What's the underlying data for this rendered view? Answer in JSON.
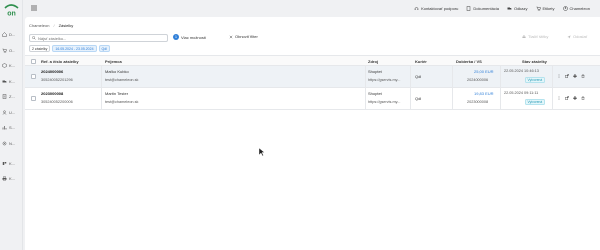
{
  "sidebar": {
    "logo_text": "on",
    "items": [
      {
        "label": "D...",
        "icon": "home-icon"
      },
      {
        "label": "O...",
        "icon": "cart-icon"
      },
      {
        "label": "K...",
        "icon": "cube-icon"
      },
      {
        "label": "K...",
        "icon": "truck-icon"
      },
      {
        "label": "Z...",
        "icon": "list-icon"
      },
      {
        "label": "U...",
        "icon": "users-icon"
      },
      {
        "label": "S...",
        "icon": "chart-icon"
      },
      {
        "label": "N...",
        "icon": "settings-icon"
      },
      {
        "label": "K...",
        "icon": "puzzle-icon"
      },
      {
        "label": "K...",
        "icon": "printer-icon"
      }
    ]
  },
  "topbar": {
    "support": "Kontaktovať podporu",
    "docs": "Dokumentácia",
    "pickups": "Odkazy",
    "labels": "Etikety",
    "user": "Chameleon"
  },
  "breadcrumb": {
    "root": "Chameleon",
    "sep": "/",
    "current": "Zásielky"
  },
  "toolbar": {
    "search_placeholder": "Nájsť zásielku...",
    "more_badge": "1",
    "more_label": "Viac možností",
    "reset_label": "Obnoviť filter",
    "print_label": "Tlačiť štítky",
    "send_label": "Odoslať"
  },
  "chips": {
    "count": "2 zásielky",
    "date": "16.05.2024 - 23.05.2024",
    "courier": "Qdl"
  },
  "table": {
    "headers": {
      "ref": "Ref. a číslo zásielky",
      "recipient": "Príjemca",
      "source": "Zdroj",
      "courier": "Kuriér",
      "cod": "Dobierka / VS",
      "status": "Stav zásielky"
    },
    "rows": [
      {
        "ref": "2024000006",
        "tracking": "305240052201296",
        "name": "Maťko Kubko",
        "email": "test@chameleon.sk",
        "source": "Shoptet",
        "source_url": "https://gservis.my...",
        "courier": "Qdl",
        "cod": "25,00 EUR",
        "vs": "2024000006",
        "date": "22.05.2024 10:46:13",
        "status": "Vytvorená"
      },
      {
        "ref": "2023000008",
        "tracking": "305240052200006",
        "name": "Martin Tester",
        "email": "test@chameleon.sk",
        "source": "Shoptet",
        "source_url": "https://gservis.my...",
        "courier": "Qdl",
        "cod": "19,83 EUR",
        "vs": "2023000008",
        "date": "22.05.2024 09:11:11",
        "status": "Vytvorená"
      }
    ]
  },
  "colors": {
    "accent": "#2f7fd8",
    "brand": "#2f8f4e",
    "status": "#2a9bb7"
  }
}
